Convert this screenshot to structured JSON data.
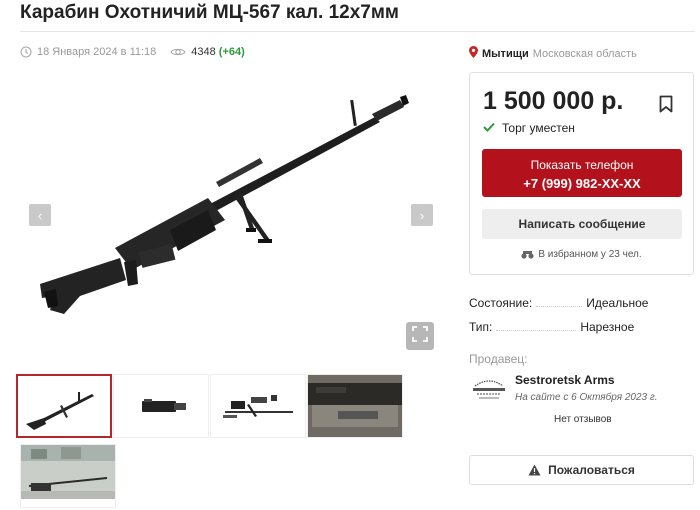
{
  "listing": {
    "title": "Карабин Охотничий МЦ-567 кал. 12х7мм",
    "date": "18 Января 2024 в 11:18",
    "views": "4348",
    "views_delta": "(+64)",
    "city": "Мытищи",
    "region": "Московская область"
  },
  "icons": {
    "clock": "clock-icon",
    "eye": "eye-icon",
    "pin": "map-pin-icon",
    "bookmark": "bookmark-icon",
    "check": "check-icon",
    "binoculars": "binoculars-icon",
    "warning": "warning-icon",
    "fullscreen": "fullscreen-icon"
  },
  "gallery": {
    "prev_glyph": "‹",
    "next_glyph": "›",
    "thumbnail_count": 5,
    "active_thumbnail": 1
  },
  "price_card": {
    "price": "1 500 000 р.",
    "bargain": "Торг уместен",
    "phone_label": "Показать телефон",
    "phone_number": "+7 (999) 982-XX-XX",
    "message_label": "Написать сообщение",
    "favorites": "В избранном у 23 чел."
  },
  "specs": [
    {
      "key": "Состояние:",
      "value": "Идеальное"
    },
    {
      "key": "Тип:",
      "value": "Нарезное"
    }
  ],
  "seller": {
    "label": "Продавец:",
    "name": "Sestroretsk Arms",
    "since": "На сайте с 6 Октября 2023 г.",
    "reviews": "Нет отзывов"
  },
  "report_label": "Пожаловаться",
  "colors": {
    "accent": "#b3121d",
    "positive": "#2e9a3c",
    "muted": "#999999"
  }
}
